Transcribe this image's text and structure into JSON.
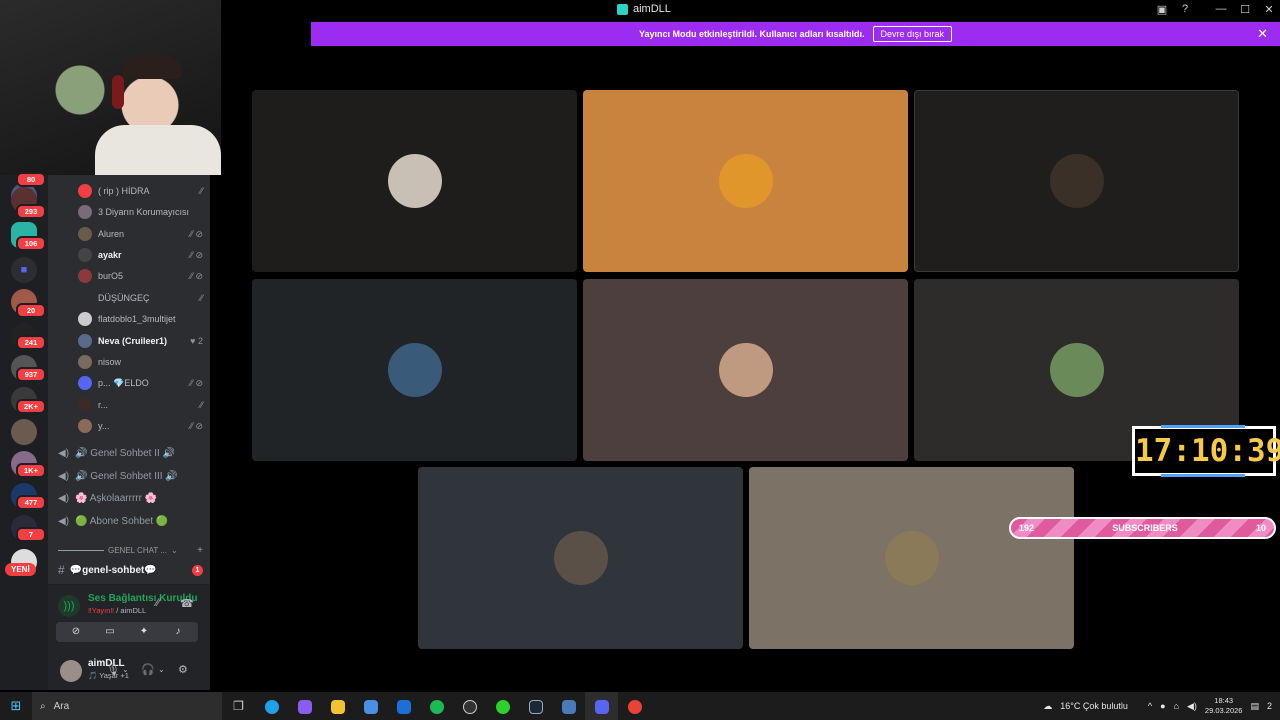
{
  "window": {
    "title": "aimDLL"
  },
  "banner": {
    "text": "Yayıncı Modu etkinleştirildi. Kullanıcı adları kısaltıldı.",
    "button": "Devre dışı bırak"
  },
  "server_badges": [
    "80",
    "293",
    "106",
    "20",
    "241",
    "937",
    "2K+",
    "1K+",
    "477",
    "7"
  ],
  "yeni_label": "YENİ",
  "voice_users": [
    {
      "name": "( rip ) HİDRA",
      "icons": "⁄⁄"
    },
    {
      "name": "3 Diyarın Korumayıcısı",
      "icons": ""
    },
    {
      "name": "Aluren",
      "icons": "⁄⁄ ⊘"
    },
    {
      "name": "ayakr",
      "icons": "⁄⁄ ⊘",
      "bold": true
    },
    {
      "name": "burO5",
      "icons": "⁄⁄ ⊘"
    },
    {
      "name": "DÜŞÜNGEÇ",
      "icons": "⁄⁄"
    },
    {
      "name": "flatdoblo1_3multijet",
      "icons": ""
    },
    {
      "name": "Neva (Cruileer1)",
      "icons": "♥ 2",
      "bold": true
    },
    {
      "name": "nisow",
      "icons": ""
    },
    {
      "name": "p... 💎ELDO",
      "icons": "⁄⁄ ⊘"
    },
    {
      "name": "r...",
      "icons": "⁄⁄"
    },
    {
      "name": "y...",
      "icons": "⁄⁄ ⊘"
    }
  ],
  "voice_channels": [
    "🔊 Genel Sohbet II 🔊",
    "🔊 Genel Sohbet III 🔊",
    "🌸 Aşkolaarrrrr 🌸",
    "🟢 Abone Sohbet 🟢"
  ],
  "category": {
    "label": "GENEL CHAT ..."
  },
  "text_channel": {
    "label": "💬genel-sohbet💬",
    "unread": "1"
  },
  "voice_panel": {
    "status": "Ses Bağlantısı Kuruldu",
    "sub_live": "‼Yayın‼",
    "sub_server": " / aimDLL"
  },
  "user_panel": {
    "name": "aimDLL",
    "status": "🎵 Yaşar +1"
  },
  "overlay": {
    "clock": "17:10:39",
    "sub_left": "192",
    "sub_label": "SUBSCRIBERS",
    "sub_right": "10"
  },
  "tile_colors": [
    "#1f1d1c",
    "#c8843e",
    "#1f1e1c",
    "#212426",
    "#4d3f3d",
    "#2d2c2b",
    "#30343b",
    "#7d7266"
  ],
  "taskbar": {
    "search_placeholder": "Ara",
    "weather": "16°C  Çok bulutlu",
    "time": "18:43",
    "date": "29.03.2026",
    "notif": "2"
  }
}
